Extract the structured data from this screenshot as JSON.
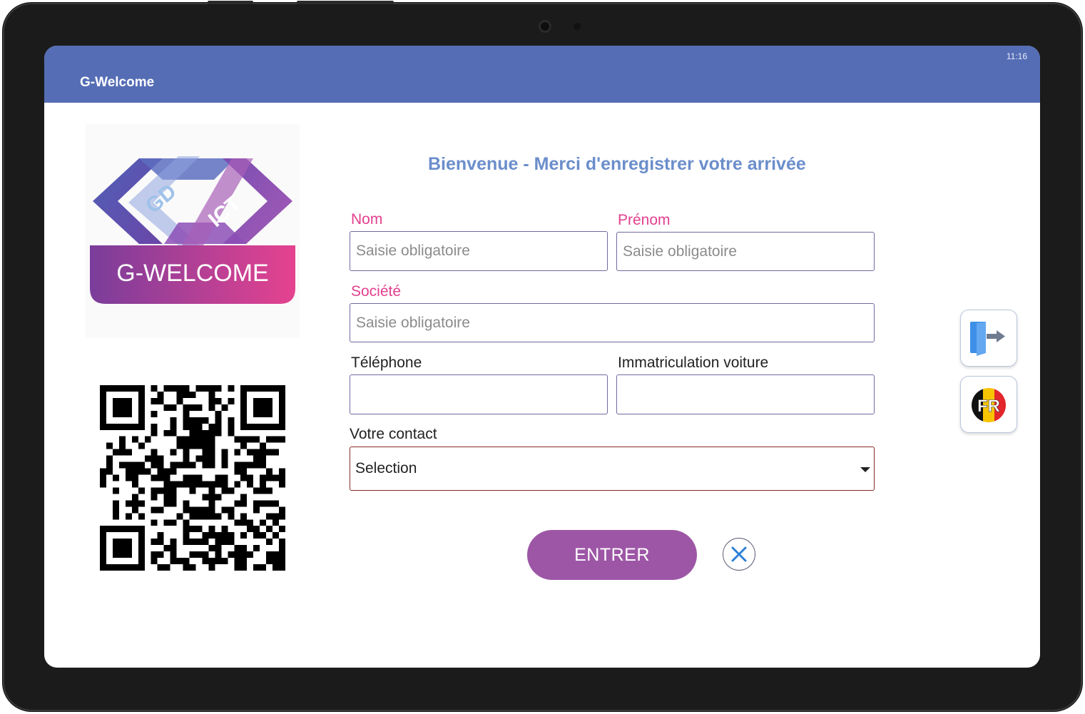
{
  "status_bar": {
    "time": "11:16"
  },
  "app": {
    "title": "G-Welcome"
  },
  "logo": {
    "top_text_left": "GD",
    "top_text_right": "ICT",
    "banner": "G-WELCOME"
  },
  "welcome": "Bienvenue - Merci d'enregistrer votre arrivée",
  "form": {
    "nom": {
      "label": "Nom",
      "placeholder": "Saisie obligatoire",
      "value": ""
    },
    "prenom": {
      "label": "Prénom",
      "placeholder": "Saisie obligatoire",
      "value": ""
    },
    "societe": {
      "label": "Société",
      "placeholder": "Saisie obligatoire",
      "value": ""
    },
    "telephone": {
      "label": "Téléphone",
      "placeholder": "",
      "value": ""
    },
    "immatriculation": {
      "label": "Immatriculation voiture",
      "placeholder": "",
      "value": ""
    },
    "contact": {
      "label": "Votre contact",
      "selected": "Selection"
    }
  },
  "actions": {
    "enter": "ENTRER"
  },
  "side": {
    "language": "FR"
  },
  "colors": {
    "appbar": "#546db5",
    "required_label": "#e2408e",
    "welcome_text": "#6b8ecb",
    "enter_button": "#9d56a6"
  },
  "icons": [
    "logout-door-icon",
    "language-flag-icon",
    "close-icon",
    "qr-code",
    "dropdown-caret-icon"
  ]
}
